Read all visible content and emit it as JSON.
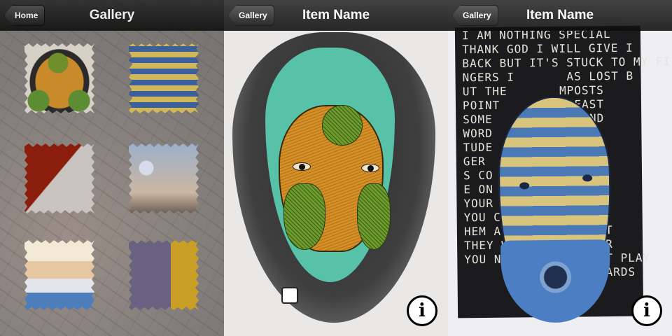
{
  "screens": {
    "gallery": {
      "nav": {
        "title": "Gallery",
        "back_label": "Home"
      },
      "thumbnails": [
        {
          "icon": "painted-mask-thumbnail"
        },
        {
          "icon": "striped-mask-poster-thumbnail"
        },
        {
          "icon": "red-fabric-thumbnail"
        },
        {
          "icon": "blurred-scene-thumbnail"
        },
        {
          "icon": "books-thumbnail"
        },
        {
          "icon": "patterned-drawing-thumbnail"
        }
      ]
    },
    "item1": {
      "nav": {
        "title": "Item Name",
        "back_label": "Gallery"
      },
      "info_icon_glyph": "i"
    },
    "item2": {
      "nav": {
        "title": "Item Name",
        "back_label": "Gallery"
      },
      "info_icon_glyph": "i",
      "poster_text": "I AM NOTHING SPECIAL\nTHANK GOD I WILL GIVE I\nBACK BUT IT'S STUCK TO MY FI\nNGERS I       AS LOST B\nUT THE       MPOSTS\nPOINT        EDEAST\nSOME         XKEIND\nWORD         SLEF\nTUDE         R FIN\nGER          NAL\nS CO         LLECT\nE ON         GOOD\nYOUR         S IN\nYOU CAN      URSE\nHEM AT       TRADE T\nTHEY WIL     HE DOOR\nYOU NEXT TO HIS LAST PLAY\n              ING CARDS"
    }
  }
}
